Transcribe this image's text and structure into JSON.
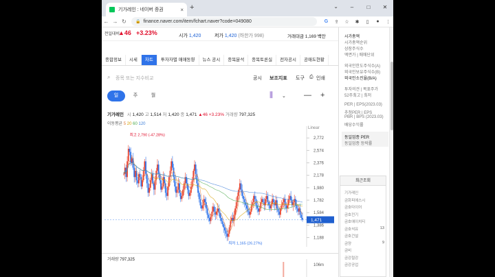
{
  "browser": {
    "tab_title": "기가레인 : 네이버 증권",
    "tab_close": "×",
    "new_tab": "+",
    "address": "finance.naver.com/item/fchart.naver?code=049080",
    "win_min": "–",
    "win_max": "□",
    "win_close": "✕",
    "tab_list": "⌄"
  },
  "infobar": {
    "label": "전일대비",
    "change": "▲46",
    "change_pct": "+3.23%",
    "high_label": "시가",
    "high_value": "1,420",
    "low_label": "저가",
    "low_value": "1,420",
    "low_note": "(하한가 998)",
    "amount_label": "거래대금",
    "amount_value": "1,169 백만"
  },
  "sidebar": {
    "items": [
      {
        "text": "시가총액",
        "gray": false
      },
      {
        "text": "시가총액순위",
        "gray": true
      },
      {
        "text": "상장주식수",
        "gray": true
      },
      {
        "text": "액면가 | 매매단위",
        "gray": true
      },
      {
        "text": "외국인한도주식수(A)",
        "gray": true
      },
      {
        "text": "외국인보유주식수(B)",
        "gray": true
      },
      {
        "text": "외국인소진율(B/A)",
        "gray": false
      },
      {
        "text": "투자의견 | 목표주가",
        "gray": true
      },
      {
        "text": "52주최고 | 최저",
        "gray": true
      },
      {
        "text": "PER | EPS(2023.03)",
        "gray": true
      },
      {
        "text": "추정PER | EPS",
        "gray": true
      },
      {
        "text": "PBR | BPS (2023.03)",
        "gray": true
      },
      {
        "text": "배당수익률",
        "gray": true
      },
      {
        "text": "동일업종 PER",
        "gray": false
      },
      {
        "text": "동일업종 등락률",
        "gray": true
      }
    ],
    "recent_title": "최근조회",
    "recent": [
      {
        "name": "기가레인",
        "num": ""
      },
      {
        "name": "금화피에스시",
        "num": ""
      },
      {
        "name": "금호타이어",
        "num": ""
      },
      {
        "name": "금호전기",
        "num": ""
      },
      {
        "name": "금호에이치티",
        "num": ""
      },
      {
        "name": "금호석유",
        "num": "13"
      },
      {
        "name": "금호건설",
        "num": ""
      },
      {
        "name": "금양",
        "num": "9"
      },
      {
        "name": "금비",
        "num": ""
      },
      {
        "name": "금강철강",
        "num": ""
      },
      {
        "name": "금강공업",
        "num": ""
      }
    ]
  },
  "navtabs": [
    "종합정보",
    "시세",
    "차트",
    "투자자별 매매동향",
    "뉴스 공시",
    "종목분석",
    "종목토론실",
    "전자공시",
    "공매도현황"
  ],
  "search": {
    "placeholder": "종목 또는 지수비교",
    "btn1": "공시",
    "btn2": "보조지표",
    "btn3": "도구",
    "btn4": "인쇄"
  },
  "period": {
    "day": "일",
    "week": "주",
    "month": "월"
  },
  "chart_header": {
    "name": "기가레인",
    "open_l": "시",
    "open": "1,420",
    "high_l": "고",
    "high": "1,514",
    "low_l": "저",
    "low": "1,420",
    "close_l": "종",
    "close": "1,471",
    "chg": "▲46 +3.23%",
    "vol_l": "거래량",
    "vol": "797,325"
  },
  "ma_header": {
    "label": "이동평균",
    "p1": "5",
    "p2": "20",
    "p3": "60",
    "p4": "120"
  },
  "chart_data": {
    "type": "candlestick",
    "scale": "Linear",
    "ylim": [
      1040,
      2960
    ],
    "yticks": [
      "2,772",
      "2,574",
      "2,376",
      "2,178",
      "1,980",
      "1,782",
      "1,584",
      "1,386",
      "1,188"
    ],
    "ytick_values": [
      2772,
      2574,
      2376,
      2178,
      1980,
      1782,
      1584,
      1386,
      1188
    ],
    "max_label": "최고 2,790 (-47.28%)",
    "min_label": "최저 1,165 (26.27%)",
    "current": "1,471",
    "current_value": 1471,
    "close_series": [
      2200,
      2300,
      2150,
      2400,
      2600,
      2550,
      2380,
      2450,
      2300,
      2150,
      2250,
      2100,
      2050,
      2200,
      2150,
      2000,
      2100,
      2250,
      2400,
      2200,
      2050,
      1900,
      1980,
      2100,
      2200,
      2050,
      1950,
      2100,
      2250,
      2350,
      2200,
      2100,
      1950,
      2000,
      2150,
      2050,
      1900,
      1850,
      2000,
      2150,
      2250,
      2400,
      2300,
      2150,
      2000,
      1900,
      1950,
      2050,
      1900,
      1800,
      1850,
      1950,
      2050,
      2150,
      2050,
      1950,
      1850,
      1900,
      2000,
      2100,
      2250,
      2350,
      2200,
      2050,
      1900,
      1800,
      1700,
      1650,
      1700,
      1800,
      1750,
      1650,
      1550,
      1500,
      1450,
      1520,
      1600,
      1680,
      1600,
      1550,
      1600,
      1650,
      1580,
      1500,
      1450,
      1400,
      1350,
      1300,
      1250,
      1200,
      1250,
      1350,
      1450,
      1500,
      1450,
      1550,
      1650,
      1750,
      1850,
      1950,
      2050,
      1950,
      1850,
      1800,
      1750,
      1700,
      1650,
      1600,
      1550,
      1600,
      1700,
      1750,
      1850,
      1800,
      1700,
      1650,
      1600,
      1650,
      1750,
      1800,
      1750,
      1700,
      1800,
      1850,
      1750,
      1700,
      1650,
      1720,
      1800,
      1750,
      1700,
      1780,
      1650,
      1600,
      1550,
      1650,
      1700,
      1750,
      1800,
      1700,
      1650,
      1700,
      1800,
      1850,
      1780,
      1700,
      1750,
      1800,
      1700,
      1650,
      1600,
      1650,
      1550,
      1500,
      1471
    ],
    "volume_label": "거래량",
    "volume": "797,325",
    "volume_axis": "106m"
  }
}
